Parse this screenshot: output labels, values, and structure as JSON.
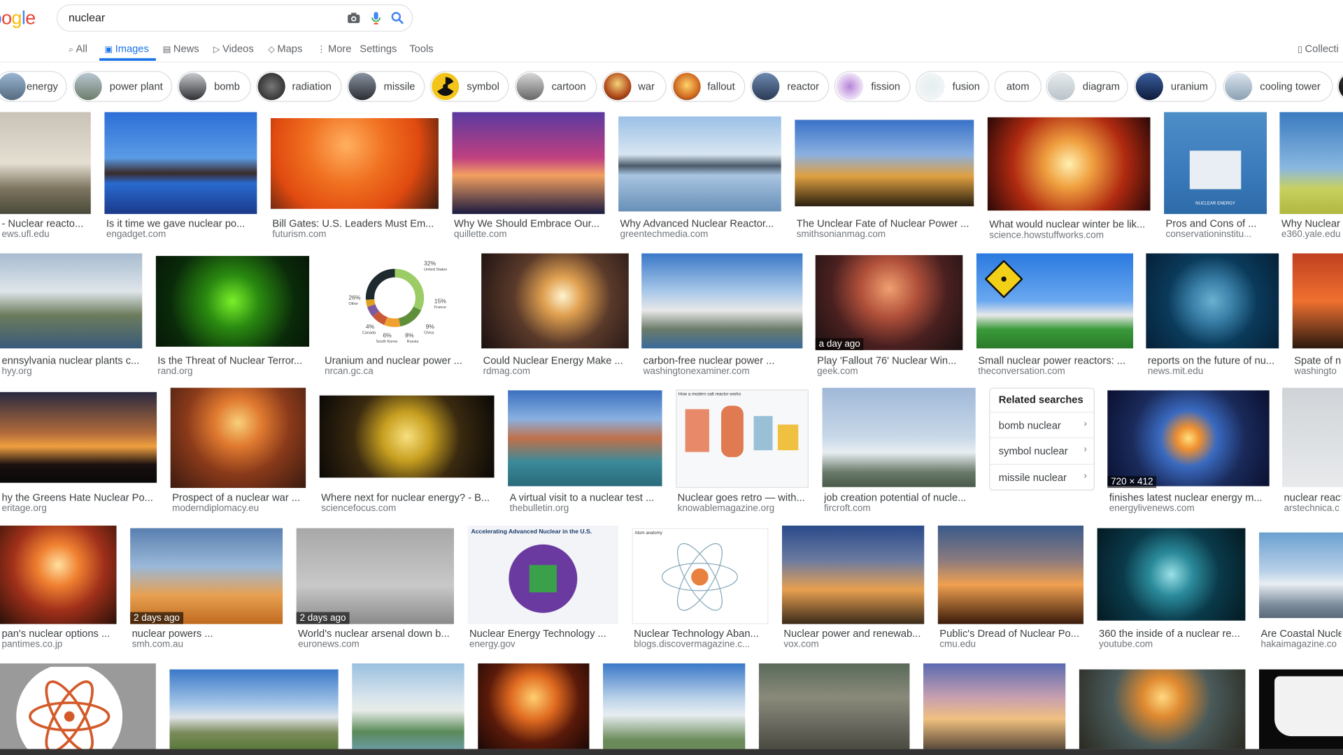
{
  "header": {
    "logo_letters": [
      "o",
      "o",
      "g",
      "l",
      "e"
    ],
    "search_query": "nuclear"
  },
  "nav": {
    "tabs": [
      {
        "id": "all",
        "label": "All",
        "icon": "search-icon"
      },
      {
        "id": "images",
        "label": "Images",
        "icon": "image-icon"
      },
      {
        "id": "news",
        "label": "News",
        "icon": "news-icon"
      },
      {
        "id": "videos",
        "label": "Videos",
        "icon": "video-icon"
      },
      {
        "id": "maps",
        "label": "Maps",
        "icon": "map-icon"
      },
      {
        "id": "more",
        "label": "More",
        "icon": "more-icon"
      },
      {
        "id": "settings",
        "label": "Settings"
      },
      {
        "id": "tools",
        "label": "Tools"
      }
    ],
    "collections_label": "Collecti"
  },
  "chips": [
    "energy",
    "power plant",
    "bomb",
    "radiation",
    "missile",
    "symbol",
    "cartoon",
    "war",
    "fallout",
    "reactor",
    "fission",
    "fusion",
    "atom",
    "diagram",
    "uranium",
    "cooling tower"
  ],
  "results": {
    "row1": [
      {
        "caption": "- Nuclear reacto...",
        "domain": "ews.ufl.edu"
      },
      {
        "caption": "Is it time we gave nuclear po...",
        "domain": "engadget.com"
      },
      {
        "caption": "Bill Gates: U.S. Leaders Must Em...",
        "domain": "futurism.com"
      },
      {
        "caption": "Why We Should Embrace Our...",
        "domain": "quillette.com"
      },
      {
        "caption": "Why Advanced Nuclear Reactor...",
        "domain": "greentechmedia.com"
      },
      {
        "caption": "The Unclear Fate of Nuclear Power ...",
        "domain": "smithsonianmag.com"
      },
      {
        "caption": "What would nuclear winter be lik...",
        "domain": "science.howstuffworks.com"
      },
      {
        "caption": "Pros and Cons of ...",
        "domain": "conservationinstitu...",
        "inner_text": "NUCLEAR ENERGY"
      },
      {
        "caption": "Why Nuclear",
        "domain": "e360.yale.edu"
      }
    ],
    "row2": [
      {
        "caption": "ennsylvania nuclear plants c...",
        "domain": "hyy.org"
      },
      {
        "caption": "Is the Threat of Nuclear Terror...",
        "domain": "rand.org"
      },
      {
        "caption": "Uranium and nuclear power ...",
        "domain": "nrcan.gc.ca"
      },
      {
        "caption": "Could Nuclear Energy Make ...",
        "domain": "rdmag.com"
      },
      {
        "caption": "carbon-free nuclear power ...",
        "domain": "washingtonexaminer.com"
      },
      {
        "caption": "Play 'Fallout 76' Nuclear Win...",
        "domain": "geek.com",
        "badge": "a day ago"
      },
      {
        "caption": "Small nuclear power reactors: ...",
        "domain": "theconversation.com"
      },
      {
        "caption": "reports on the future of nu...",
        "domain": "news.mit.edu"
      },
      {
        "caption": "Spate of n",
        "domain": "washingto"
      }
    ],
    "donut": {
      "labels": [
        "32%",
        "United States",
        "26%",
        "Other",
        "15%",
        "France",
        "4%",
        "Canada",
        "6%",
        "South Korea",
        "8%",
        "Russia",
        "9%",
        "China"
      ],
      "values": [
        32,
        15,
        9,
        8,
        6,
        4,
        26
      ],
      "colors": [
        "#9ccc65",
        "#5f8f3a",
        "#f0a030",
        "#c85a3a",
        "#7a5aa0",
        "#e0a020",
        "#1f2a2e"
      ]
    },
    "row3": [
      {
        "caption": "hy the Greens Hate Nuclear Po...",
        "domain": "eritage.org"
      },
      {
        "caption": "Prospect of a nuclear war ...",
        "domain": "moderndiplomacy.eu"
      },
      {
        "caption": "Where next for nuclear energy? - B...",
        "domain": "sciencefocus.com"
      },
      {
        "caption": "A virtual visit to a nuclear test ...",
        "domain": "thebulletin.org"
      },
      {
        "caption": "Nuclear goes retro — with...",
        "domain": "knowablemagazine.org",
        "inner_text": "How a modern salt reactor works"
      },
      {
        "caption": "job creation potential of nucle...",
        "domain": "fircroft.com"
      },
      {
        "caption": "finishes latest nuclear energy m...",
        "domain": "energylivenews.com",
        "badge": "720 × 412"
      },
      {
        "caption": "nuclear react",
        "domain": "arstechnica.c"
      }
    ],
    "row4": [
      {
        "caption": "pan's nuclear options ...",
        "domain": "pantimes.co.jp"
      },
      {
        "caption": "nuclear powers ...",
        "domain": "smh.com.au",
        "badge": "2 days ago"
      },
      {
        "caption": "World's nuclear arsenal down b...",
        "domain": "euronews.com",
        "badge": "2 days ago"
      },
      {
        "caption": "Nuclear Energy Technology ...",
        "domain": "energy.gov",
        "inner_text": "Accelerating Advanced Nuclear in the U.S."
      },
      {
        "caption": "Nuclear Technology Aban...",
        "domain": "blogs.discovermagazine.c...",
        "inner_text": "Atom anatomy"
      },
      {
        "caption": "Nuclear power and renewab...",
        "domain": "vox.com"
      },
      {
        "caption": "Public's Dread of Nuclear Po...",
        "domain": "cmu.edu"
      },
      {
        "caption": "360 the inside of a nuclear re...",
        "domain": "youtube.com"
      },
      {
        "caption": "Are Coastal Nucle",
        "domain": "hakaimagazine.co"
      }
    ]
  },
  "related": {
    "title": "Related searches",
    "items": [
      "bomb nuclear",
      "symbol nuclear",
      "missile nuclear"
    ]
  }
}
